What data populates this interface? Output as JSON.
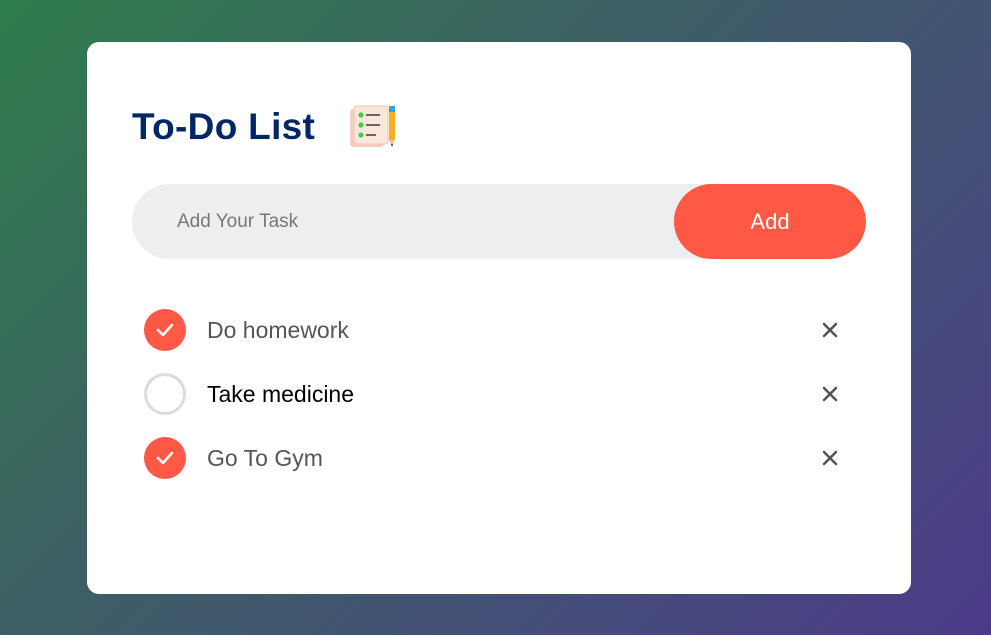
{
  "header": {
    "title": "To-Do List",
    "icon": "notepad-checklist-icon"
  },
  "input": {
    "placeholder": "Add Your Task",
    "value": "",
    "add_label": "Add"
  },
  "tasks": [
    {
      "text": "Do homework",
      "checked": true
    },
    {
      "text": "Take medicine",
      "checked": false
    },
    {
      "text": "Go To Gym",
      "checked": true
    }
  ],
  "colors": {
    "accent": "#ff5945",
    "title": "#002765",
    "input_bg": "#edeef0"
  },
  "icons": {
    "check": "checkmark-icon",
    "remove": "close-icon"
  }
}
